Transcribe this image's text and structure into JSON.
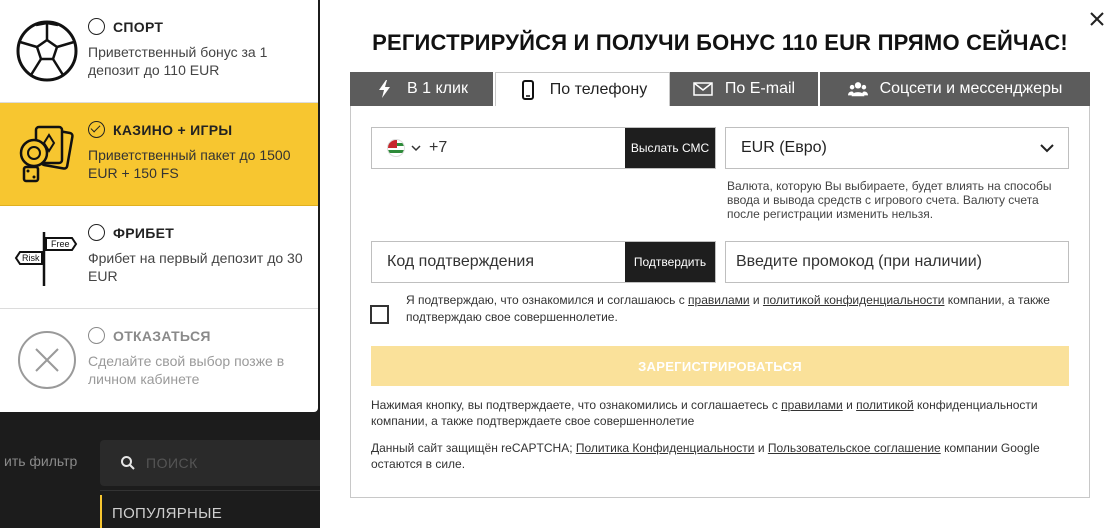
{
  "site": {
    "filter_label": "ить фильтр",
    "search_placeholder": "ПОИСК",
    "popular_label": "ПОПУЛЯРНЫЕ"
  },
  "bonus_options": [
    {
      "title": "СПОРТ",
      "desc": "Приветственный бонус за 1 депозит до 110 EUR",
      "icon": "soccer-ball-icon",
      "selected": false
    },
    {
      "title": "КАЗИНО + ИГРЫ",
      "desc": "Приветственный пакет до 1500 EUR + 150 FS",
      "icon": "casino-chips-cards-icon",
      "selected": true
    },
    {
      "title": "ФРИБЕТ",
      "desc": "Фрибет на первый депозит до 30 EUR",
      "icon": "signpost-icon",
      "selected": false,
      "signpost_free": "Free",
      "signpost_risk": "Risk"
    },
    {
      "title": "ОТКАЗАТЬСЯ",
      "desc": "Сделайте свой выбор позже в личном кабинете",
      "icon": "decline-circle-icon",
      "selected": false
    }
  ],
  "registration": {
    "title": "РЕГИСТРИРУЙСЯ И ПОЛУЧИ БОНУС 110 EUR ПРЯМО СЕЙЧАС!",
    "tabs": [
      {
        "label": "В 1 клик",
        "icon": "lightning-icon",
        "active": false
      },
      {
        "label": "По телефону",
        "icon": "phone-icon",
        "active": true
      },
      {
        "label": "По E-mail",
        "icon": "envelope-icon",
        "active": false
      },
      {
        "label": "Соцсети и мессенджеры",
        "icon": "people-icon",
        "active": false
      }
    ],
    "phone": {
      "country_flag": "abkhazia-flag-icon",
      "code": "+7",
      "send_sms_label": "Выслать СМС"
    },
    "currency": {
      "selected": "EUR (Евро)",
      "note": "Валюта, которую Вы выбираете, будет влиять на способы ввода и вывода средств с игрового счета. Валюту счета после регистрации изменить нельзя."
    },
    "confirmation": {
      "placeholder": "Код подтверждения",
      "confirm_label": "Подтвердить"
    },
    "promo": {
      "placeholder": "Введите промокод (при наличии)"
    },
    "agreement": {
      "part1": "Я подтверждаю, что ознакомился и соглашаюсь с ",
      "rules_link": "правилами",
      "part2": " и ",
      "privacy_link": "политикой конфиденциальности",
      "part3": " компании, а также подтверждаю свое совершеннолетие."
    },
    "register_label": "ЗАРЕГИСТРИРОВАТЬСЯ",
    "legal1": {
      "part1": "Нажимая кнопку, вы подтверждаете, что ознакомились и соглашаетесь с ",
      "rules_link": "правилами",
      "part2": " и ",
      "policy_link": "политикой",
      "part3": " конфиденциальности компании, а также подтверждаете свое совершеннолетие"
    },
    "legal2": {
      "part1": "Данный сайт защищён reCAPTCHA; ",
      "privacy_link": "Политика Конфиденциальности",
      "part2": " и ",
      "terms_link": "Пользовательское соглашение",
      "part3": " компании Google остаются в силе."
    }
  },
  "colors": {
    "accent": "#f7c630",
    "register_button": "#fae19a",
    "tab_inactive": "#5c5c5c",
    "dark_button": "#1e1e1e"
  }
}
